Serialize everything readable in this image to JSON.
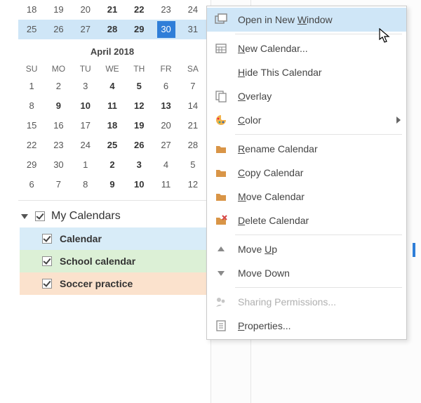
{
  "sidebar": {
    "months": [
      {
        "title": "",
        "rows": [
          {
            "days": [
              "18",
              "19",
              "20",
              "21",
              "22",
              "23",
              "24"
            ],
            "bold": [
              3,
              4
            ],
            "selected": false
          },
          {
            "days": [
              "25",
              "26",
              "27",
              "28",
              "29",
              "30",
              "31"
            ],
            "bold": [
              3,
              4
            ],
            "selected": true,
            "today_index": 5
          }
        ],
        "show_header": false
      },
      {
        "title": "April 2018",
        "dow": [
          "SU",
          "MO",
          "TU",
          "WE",
          "TH",
          "FR",
          "SA"
        ],
        "rows": [
          {
            "days": [
              "1",
              "2",
              "3",
              "4",
              "5",
              "6",
              "7"
            ],
            "bold": [
              3,
              4
            ]
          },
          {
            "days": [
              "8",
              "9",
              "10",
              "11",
              "12",
              "13",
              "14"
            ],
            "bold": [
              1,
              2,
              3,
              4,
              5
            ]
          },
          {
            "days": [
              "15",
              "16",
              "17",
              "18",
              "19",
              "20",
              "21"
            ],
            "bold": [
              3,
              4
            ]
          },
          {
            "days": [
              "22",
              "23",
              "24",
              "25",
              "26",
              "27",
              "28"
            ],
            "bold": [
              3,
              4
            ]
          },
          {
            "days": [
              "29",
              "30",
              "1",
              "2",
              "3",
              "4",
              "5"
            ],
            "bold": [
              3,
              4
            ]
          },
          {
            "days": [
              "6",
              "7",
              "8",
              "9",
              "10",
              "11",
              "12"
            ],
            "bold": [
              3,
              4
            ]
          }
        ],
        "show_header": true
      }
    ],
    "group_title": "My Calendars",
    "calendars": [
      {
        "label": "Calendar",
        "checked": true,
        "color": "#d8ecf8"
      },
      {
        "label": "School calendar",
        "checked": true,
        "color": "#dcf0d6"
      },
      {
        "label": "Soccer practice",
        "checked": true,
        "color": "#fbe2cd"
      }
    ]
  },
  "grid": {
    "visible_number": "6"
  },
  "context_menu": {
    "items": [
      {
        "label": "Open in New Window",
        "mnemonic": "W",
        "icon": "open-in-new-window-icon",
        "highlight": true
      },
      {
        "label": "New Calendar...",
        "mnemonic": "N",
        "icon": "new-calendar-icon"
      },
      {
        "label": "Hide This Calendar",
        "mnemonic": "H",
        "icon": ""
      },
      {
        "label": "Overlay",
        "mnemonic": "O",
        "icon": "overlay-icon"
      },
      {
        "label": "Color",
        "mnemonic": "C",
        "icon": "color-icon",
        "submenu": true
      },
      {
        "label": "Rename Calendar",
        "mnemonic": "R",
        "icon": "folder-rename-icon"
      },
      {
        "label": "Copy Calendar",
        "mnemonic": "C",
        "icon": "folder-copy-icon"
      },
      {
        "label": "Move Calendar",
        "mnemonic": "M",
        "icon": "folder-move-icon"
      },
      {
        "label": "Delete Calendar",
        "mnemonic": "D",
        "icon": "folder-delete-icon"
      },
      {
        "label": "Move Up",
        "mnemonic": "U",
        "icon": "triangle-up-icon"
      },
      {
        "label": "Move Down",
        "mnemonic": "",
        "icon": "triangle-down-icon"
      },
      {
        "label": "Sharing Permissions...",
        "mnemonic": "",
        "icon": "sharing-icon",
        "disabled": true
      },
      {
        "label": "Properties...",
        "mnemonic": "P",
        "icon": "properties-icon"
      }
    ]
  }
}
